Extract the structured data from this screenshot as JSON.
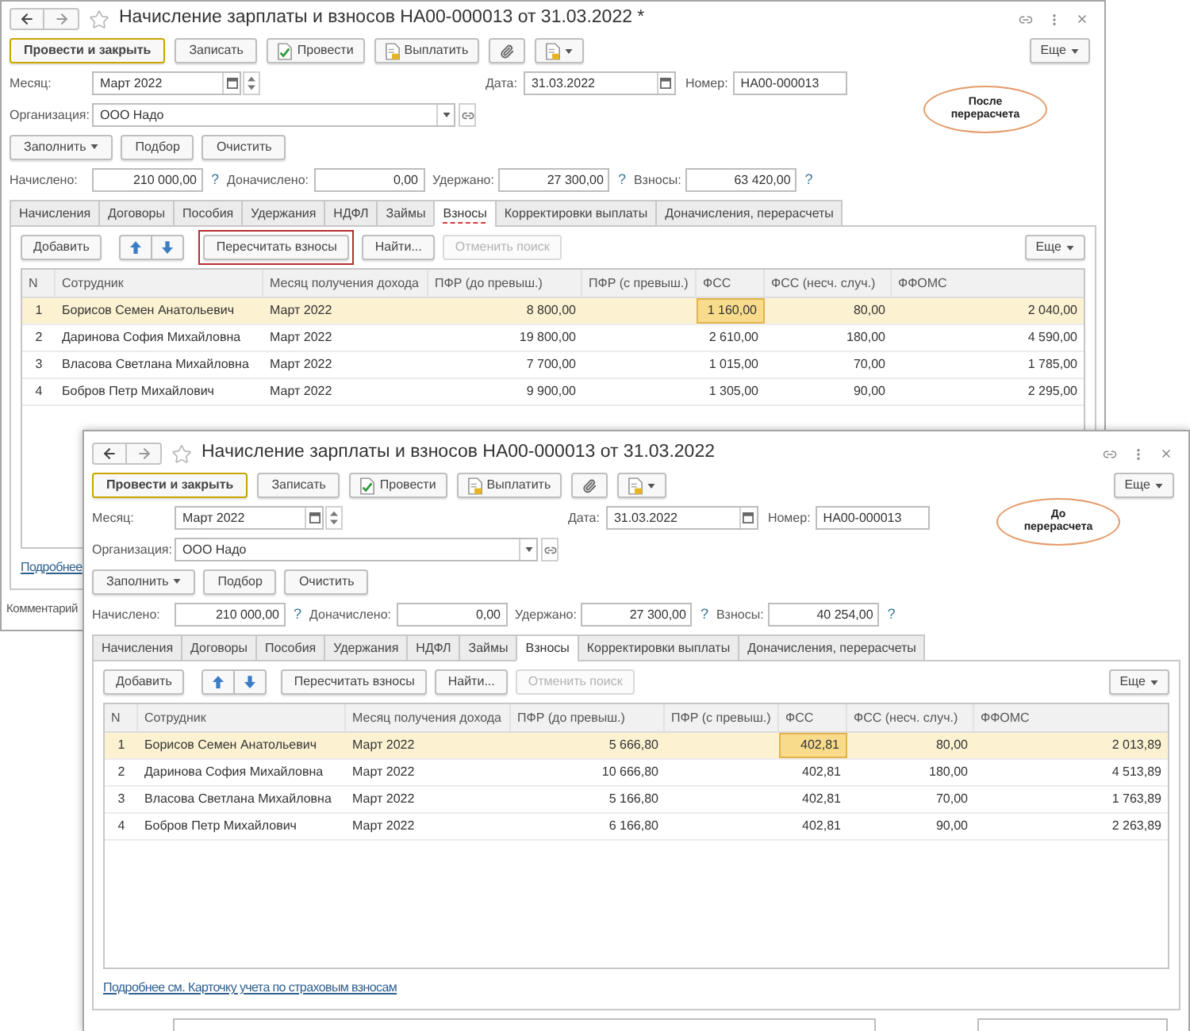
{
  "windows": [
    {
      "title": "Начисление зарплаты и взносов НА00-000013 от 31.03.2022 *",
      "toolbar": [
        {
          "kind": "primary",
          "label": "Провести и закрыть"
        },
        {
          "kind": "plain",
          "label": "Записать"
        },
        {
          "kind": "post",
          "label": "Провести"
        },
        {
          "kind": "pay",
          "label": "Выплатить"
        },
        {
          "kind": "attach"
        },
        {
          "kind": "print"
        }
      ],
      "more_label": "Еще",
      "month": {
        "label": "Месяц:",
        "value": "Март 2022"
      },
      "date": {
        "label": "Дата:",
        "value": "31.03.2022"
      },
      "number": {
        "label": "Номер:",
        "value": "НА00-000013"
      },
      "organization": {
        "label": "Организация:",
        "value": "ООО Надо"
      },
      "note": "После перерасчета",
      "fill_buttons": [
        {
          "label": "Заполнить",
          "dropdown": true
        },
        {
          "label": "Подбор",
          "dropdown": false
        },
        {
          "label": "Очистить",
          "dropdown": false
        }
      ],
      "totals": [
        {
          "label": "Начислено:",
          "value": "210 000,00",
          "hint": "?"
        },
        {
          "label": "Доначислено:",
          "value": "0,00"
        },
        {
          "label": "Удержано:",
          "value": "27 300,00",
          "hint": "?"
        },
        {
          "label": "Взносы:",
          "value": "63 420,00",
          "hint": "?"
        }
      ],
      "tabs": [
        {
          "label": "Начисления",
          "selected": false,
          "underlined": false
        },
        {
          "label": "Договоры",
          "selected": false,
          "underlined": false
        },
        {
          "label": "Пособия",
          "selected": false,
          "underlined": false
        },
        {
          "label": "Удержания",
          "selected": false,
          "underlined": false
        },
        {
          "label": "НДФЛ",
          "selected": false,
          "underlined": false
        },
        {
          "label": "Займы",
          "selected": false,
          "underlined": false
        },
        {
          "label": "Взносы",
          "selected": true,
          "underlined": true
        },
        {
          "label": "Корректировки выплаты",
          "selected": false,
          "underlined": false
        },
        {
          "label": "Доначисления, перерасчеты",
          "selected": false,
          "underlined": false
        }
      ],
      "table_toolbar": [
        {
          "kind": "button",
          "label": "Добавить",
          "disabled": false,
          "highlighted": false
        },
        {
          "kind": "move"
        },
        {
          "kind": "button",
          "label": "Пересчитать взносы",
          "disabled": false,
          "highlighted": true
        },
        {
          "kind": "button",
          "label": "Найти...",
          "disabled": false,
          "highlighted": false
        },
        {
          "kind": "button",
          "label": "Отменить поиск",
          "disabled": true,
          "highlighted": false
        }
      ],
      "table_more_label": "Еще",
      "table": {
        "columns": [
          {
            "label": "N",
            "kind": "index",
            "current": false
          },
          {
            "label": "Сотрудник",
            "kind": "text",
            "current": false
          },
          {
            "label": "Месяц получения дохода",
            "kind": "text",
            "current": false
          },
          {
            "label": "ПФР (до превыш.)",
            "kind": "number",
            "current": false
          },
          {
            "label": "ПФР (с превыш.)",
            "kind": "number",
            "current": false
          },
          {
            "label": "ФСС",
            "kind": "number",
            "current": true
          },
          {
            "label": "ФСС (несч. случ.)",
            "kind": "number",
            "current": false
          },
          {
            "label": "ФФОМС",
            "kind": "number",
            "current": false
          }
        ],
        "rows": [
          {
            "selected": true,
            "n": "1",
            "employee": "Борисов Семен Анатольевич",
            "month": "Март 2022",
            "pfr_base": "8 800,00",
            "fss": "1 160,00",
            "fss_accident": "80,00",
            "ffoms": "2 040,00"
          },
          {
            "selected": false,
            "n": "2",
            "employee": "Даринова София Михайловна",
            "month": "Март 2022",
            "pfr_base": "19 800,00",
            "fss": "2 610,00",
            "fss_accident": "180,00",
            "ffoms": "4 590,00"
          },
          {
            "selected": false,
            "n": "3",
            "employee": "Власова Светлана Михайловна",
            "month": "Март 2022",
            "pfr_base": "7 700,00",
            "fss": "1 015,00",
            "fss_accident": "70,00",
            "ffoms": "1 785,00"
          },
          {
            "selected": false,
            "n": "4",
            "employee": "Бобров Петр Михайлович",
            "month": "Март 2022",
            "pfr_base": "9 900,00",
            "fss": "1 305,00",
            "fss_accident": "90,00",
            "ffoms": "2 295,00"
          }
        ]
      },
      "footer_link": "Подробнее",
      "comment_label": "Комментарий",
      "comment_field_visible": false
    },
    {
      "title": "Начисление зарплаты и взносов НА00-000013 от 31.03.2022",
      "toolbar": [
        {
          "kind": "primary",
          "label": "Провести и закрыть"
        },
        {
          "kind": "plain",
          "label": "Записать"
        },
        {
          "kind": "post",
          "label": "Провести"
        },
        {
          "kind": "pay",
          "label": "Выплатить"
        },
        {
          "kind": "attach"
        },
        {
          "kind": "print"
        }
      ],
      "more_label": "Еще",
      "month": {
        "label": "Месяц:",
        "value": "Март 2022"
      },
      "date": {
        "label": "Дата:",
        "value": "31.03.2022"
      },
      "number": {
        "label": "Номер:",
        "value": "НА00-000013"
      },
      "organization": {
        "label": "Организация:",
        "value": "ООО Надо"
      },
      "note": "До перерасчета",
      "fill_buttons": [
        {
          "label": "Заполнить",
          "dropdown": true
        },
        {
          "label": "Подбор",
          "dropdown": false
        },
        {
          "label": "Очистить",
          "dropdown": false
        }
      ],
      "totals": [
        {
          "label": "Начислено:",
          "value": "210 000,00",
          "hint": "?"
        },
        {
          "label": "Доначислено:",
          "value": "0,00"
        },
        {
          "label": "Удержано:",
          "value": "27 300,00",
          "hint": "?"
        },
        {
          "label": "Взносы:",
          "value": "40 254,00",
          "hint": "?"
        }
      ],
      "tabs": [
        {
          "label": "Начисления",
          "selected": false,
          "underlined": false
        },
        {
          "label": "Договоры",
          "selected": false,
          "underlined": false
        },
        {
          "label": "Пособия",
          "selected": false,
          "underlined": false
        },
        {
          "label": "Удержания",
          "selected": false,
          "underlined": false
        },
        {
          "label": "НДФЛ",
          "selected": false,
          "underlined": false
        },
        {
          "label": "Займы",
          "selected": false,
          "underlined": false
        },
        {
          "label": "Взносы",
          "selected": true,
          "underlined": false
        },
        {
          "label": "Корректировки выплаты",
          "selected": false,
          "underlined": false
        },
        {
          "label": "Доначисления, перерасчеты",
          "selected": false,
          "underlined": false
        }
      ],
      "table_toolbar": [
        {
          "kind": "button",
          "label": "Добавить",
          "disabled": false,
          "highlighted": false
        },
        {
          "kind": "move"
        },
        {
          "kind": "button",
          "label": "Пересчитать взносы",
          "disabled": false,
          "highlighted": false
        },
        {
          "kind": "button",
          "label": "Найти...",
          "disabled": false,
          "highlighted": false
        },
        {
          "kind": "button",
          "label": "Отменить поиск",
          "disabled": true,
          "highlighted": false
        }
      ],
      "table_more_label": "Еще",
      "table": {
        "columns": [
          {
            "label": "N",
            "kind": "index",
            "current": false
          },
          {
            "label": "Сотрудник",
            "kind": "text",
            "current": false
          },
          {
            "label": "Месяц получения дохода",
            "kind": "text",
            "current": false
          },
          {
            "label": "ПФР (до превыш.)",
            "kind": "number",
            "current": false
          },
          {
            "label": "ПФР (с превыш.)",
            "kind": "number",
            "current": false
          },
          {
            "label": "ФСС",
            "kind": "number",
            "current": true
          },
          {
            "label": "ФСС (несч. случ.)",
            "kind": "number",
            "current": false
          },
          {
            "label": "ФФОМС",
            "kind": "number",
            "current": false
          }
        ],
        "rows": [
          {
            "selected": true,
            "n": "1",
            "employee": "Борисов Семен Анатольевич",
            "month": "Март 2022",
            "pfr_base": "5 666,80",
            "fss": "402,81",
            "fss_accident": "80,00",
            "ffoms": "2 013,89"
          },
          {
            "selected": false,
            "n": "2",
            "employee": "Даринова София Михайловна",
            "month": "Март 2022",
            "pfr_base": "10 666,80",
            "fss": "402,81",
            "fss_accident": "180,00",
            "ffoms": "4 513,89"
          },
          {
            "selected": false,
            "n": "3",
            "employee": "Власова Светлана Михайловна",
            "month": "Март 2022",
            "pfr_base": "5 166,80",
            "fss": "402,81",
            "fss_accident": "70,00",
            "ffoms": "1 763,89"
          },
          {
            "selected": false,
            "n": "4",
            "employee": "Бобров Петр Михайлович",
            "month": "Март 2022",
            "pfr_base": "6 166,80",
            "fss": "402,81",
            "fss_accident": "90,00",
            "ffoms": "2 263,89"
          }
        ]
      },
      "footer_link": "Подробнее см. Карточку учета по страховым взносам",
      "comment_field_visible": true
    }
  ]
}
